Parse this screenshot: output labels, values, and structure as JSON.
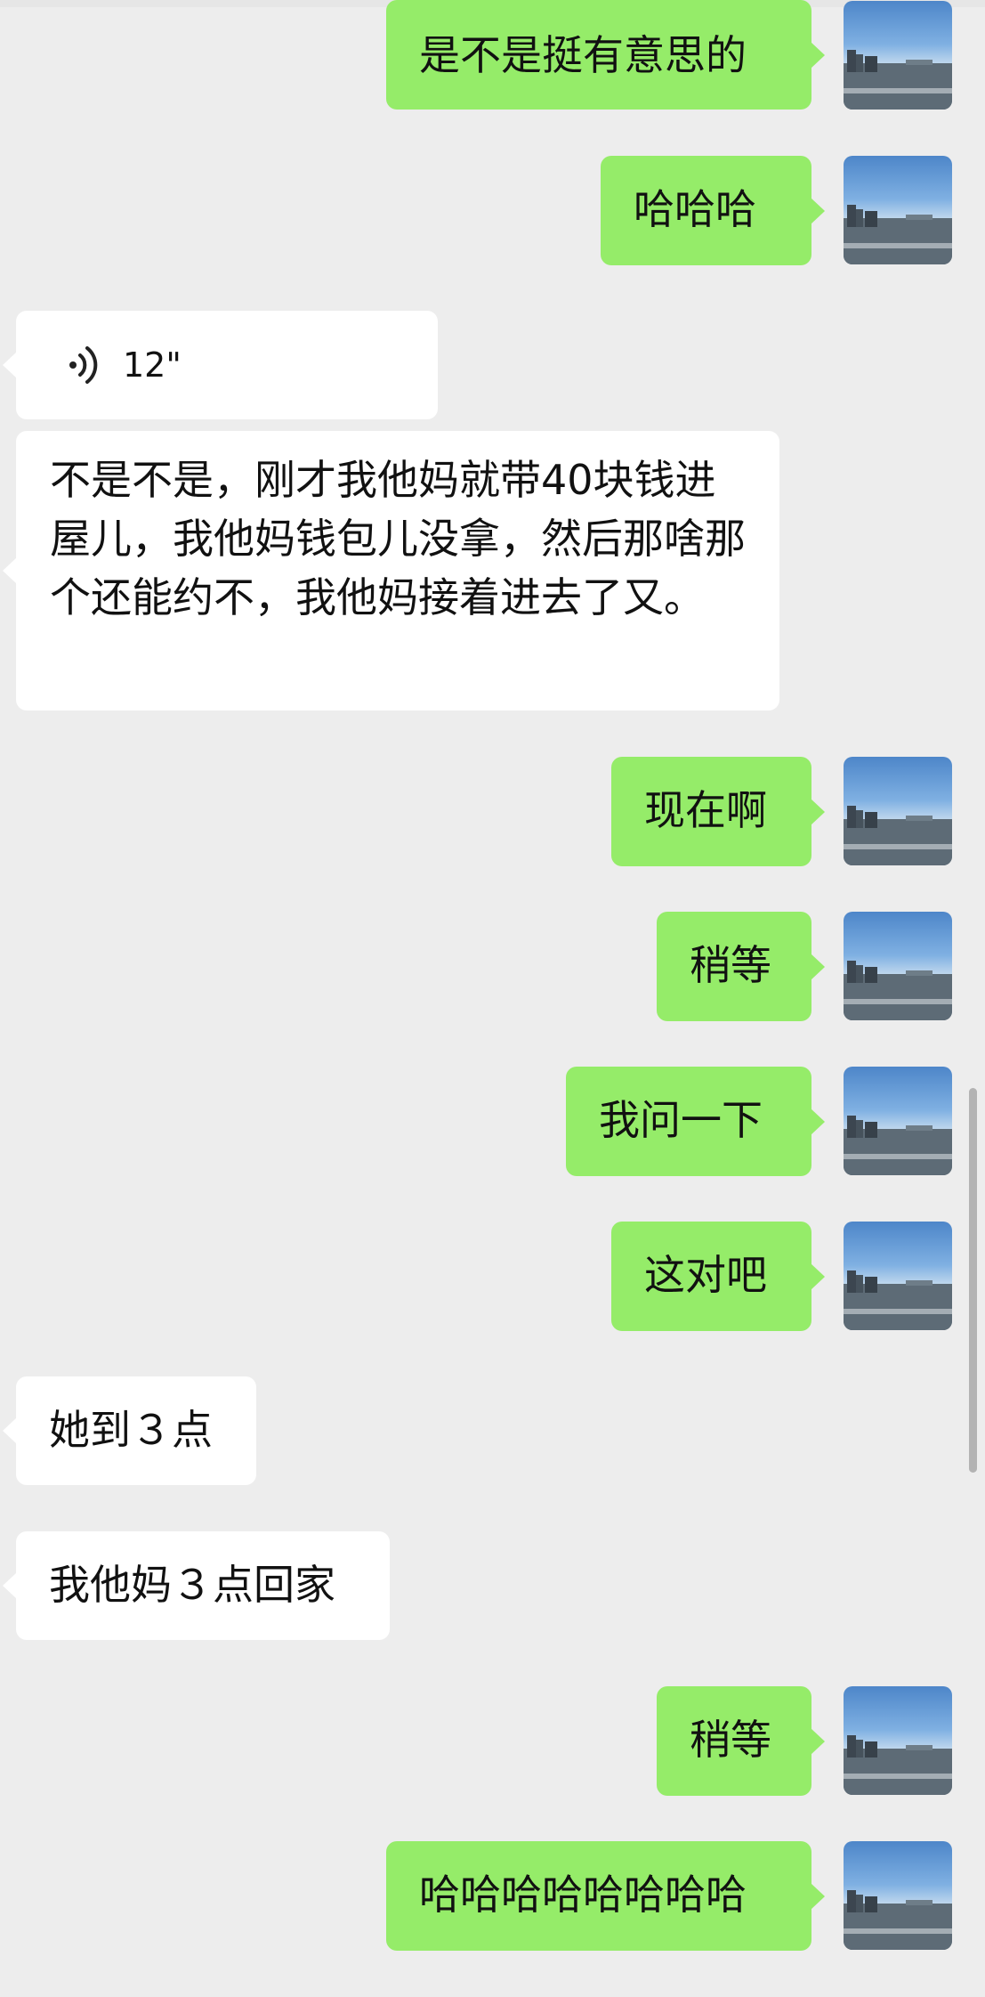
{
  "colors": {
    "background": "#ededed",
    "outgoing_bubble": "#95ec69",
    "incoming_bubble": "#ffffff"
  },
  "messages": [
    {
      "side": "out",
      "text": "是不是挺有意思的"
    },
    {
      "side": "out",
      "text": "哈哈哈"
    },
    {
      "side": "in",
      "type": "voice",
      "duration": "12\"",
      "icon": "voice-waves-icon"
    },
    {
      "side": "in",
      "text": "不是不是，刚才我他妈就带40块钱进屋儿，我他妈钱包儿没拿，然后那啥那个还能约不，我他妈接着进去了又。"
    },
    {
      "side": "out",
      "text": "现在啊"
    },
    {
      "side": "out",
      "text": "稍等"
    },
    {
      "side": "out",
      "text": "我问一下"
    },
    {
      "side": "out",
      "text": "这对吧"
    },
    {
      "side": "in",
      "text": "她到３点"
    },
    {
      "side": "in",
      "text": "我他妈３点回家"
    },
    {
      "side": "out",
      "text": "稍等"
    },
    {
      "side": "out",
      "text": "哈哈哈哈哈哈哈哈"
    }
  ]
}
